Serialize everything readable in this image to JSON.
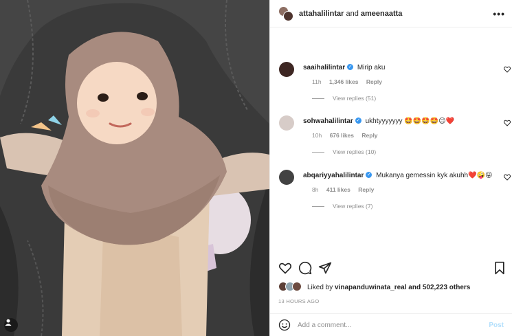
{
  "header": {
    "user1": "attahalilintar",
    "conjunction": "and",
    "user2": "ameenaatta",
    "more_label": "•••"
  },
  "comments": [
    {
      "username": "saaihalilintar",
      "text": "Mirip aku",
      "age": "11h",
      "likes": "1,346 likes",
      "reply_label": "Reply",
      "view_replies": "View replies (51)",
      "avatar_color": "#3e2723"
    },
    {
      "username": "sohwahalilintar",
      "text": "ukhtyyyyyyy 🤩🤩🤩🤩😉❤️",
      "age": "10h",
      "likes": "676 likes",
      "reply_label": "Reply",
      "view_replies": "View replies (10)",
      "avatar_color": "#d7ccc8"
    },
    {
      "username": "abqariyyahalilintar",
      "text": "Mukanya gemessin kyk akuhh❤️🤪😛",
      "age": "8h",
      "likes": "411 likes",
      "reply_label": "Reply",
      "view_replies": "View replies (7)",
      "avatar_color": "#424242"
    }
  ],
  "likes": {
    "prefix": "Liked by",
    "user": "vinapanduwinata_real",
    "suffix": "and 502,223 others"
  },
  "timestamp": "13 HOURS AGO",
  "add_comment": {
    "placeholder": "Add a comment...",
    "post_label": "Post"
  },
  "colors": {
    "verified": "#3897f0",
    "post_disabled": "#b2dffc",
    "muted": "#8e8e8e"
  }
}
